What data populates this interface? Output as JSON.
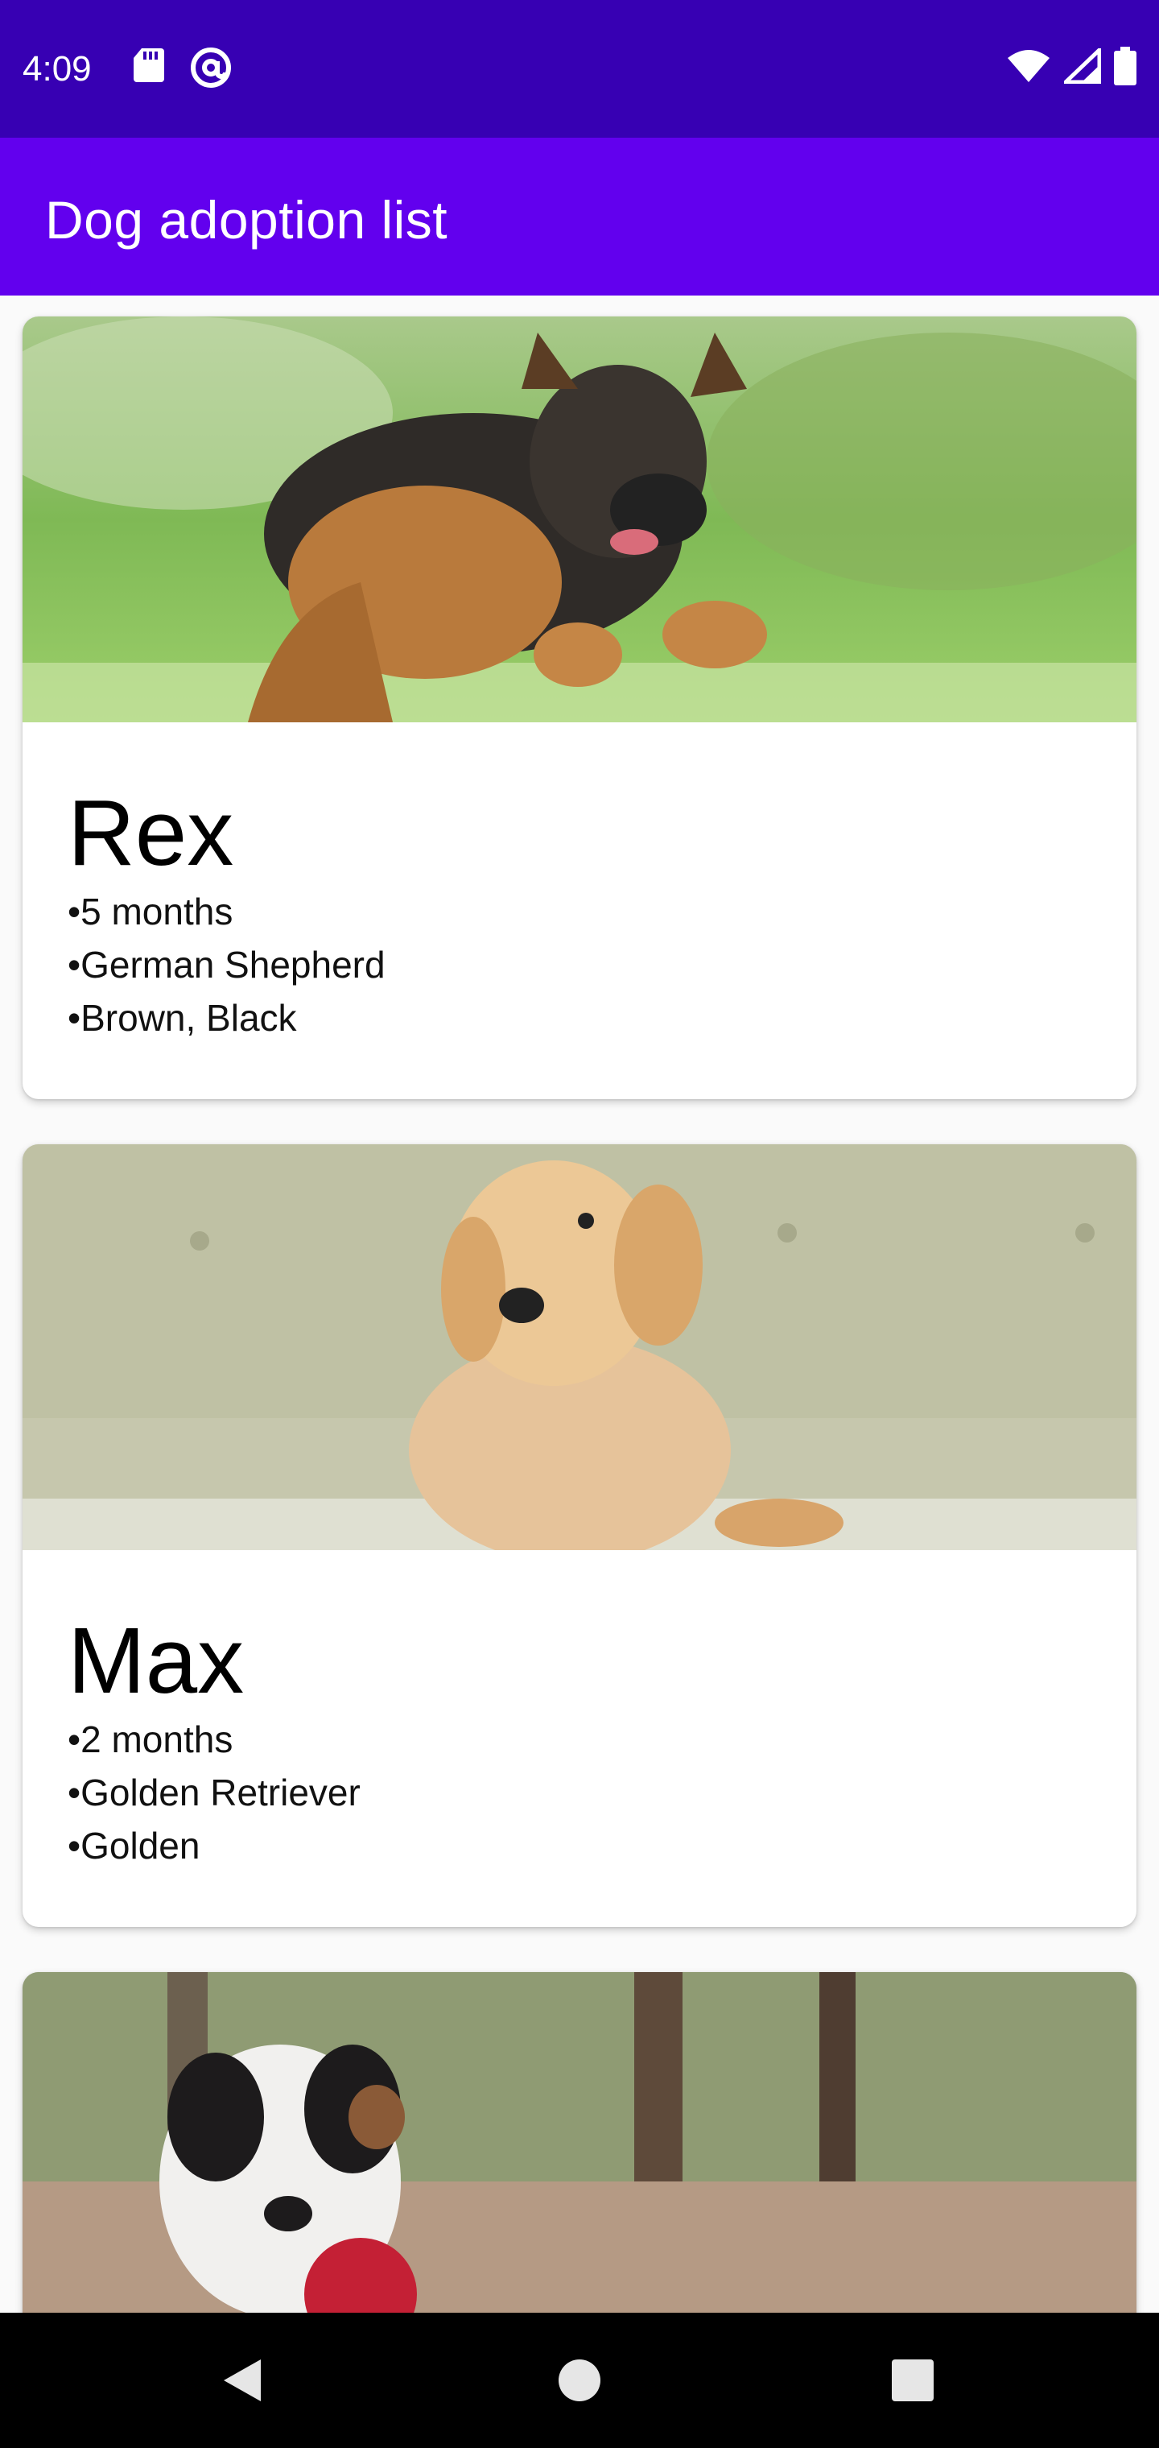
{
  "status_bar": {
    "time": "4:09",
    "left_icons": [
      "sd-card-icon",
      "at-sign-icon"
    ],
    "right_icons": [
      "wifi-icon",
      "signal-icon",
      "battery-icon"
    ]
  },
  "app_bar": {
    "title": "Dog adoption list"
  },
  "dogs": [
    {
      "name": "Rex",
      "details": [
        "5 months",
        "German Shepherd",
        "Brown, Black"
      ]
    },
    {
      "name": "Max",
      "details": [
        "2 months",
        "Golden Retriever",
        "Golden"
      ]
    },
    {
      "name": "",
      "details": []
    }
  ],
  "nav_bar": {
    "buttons": [
      "back-icon",
      "home-icon",
      "recents-icon"
    ]
  },
  "colors": {
    "status_bar": "#3700b3",
    "app_bar": "#6200ee",
    "nav_bar": "#000000",
    "card_bg": "#ffffff"
  }
}
